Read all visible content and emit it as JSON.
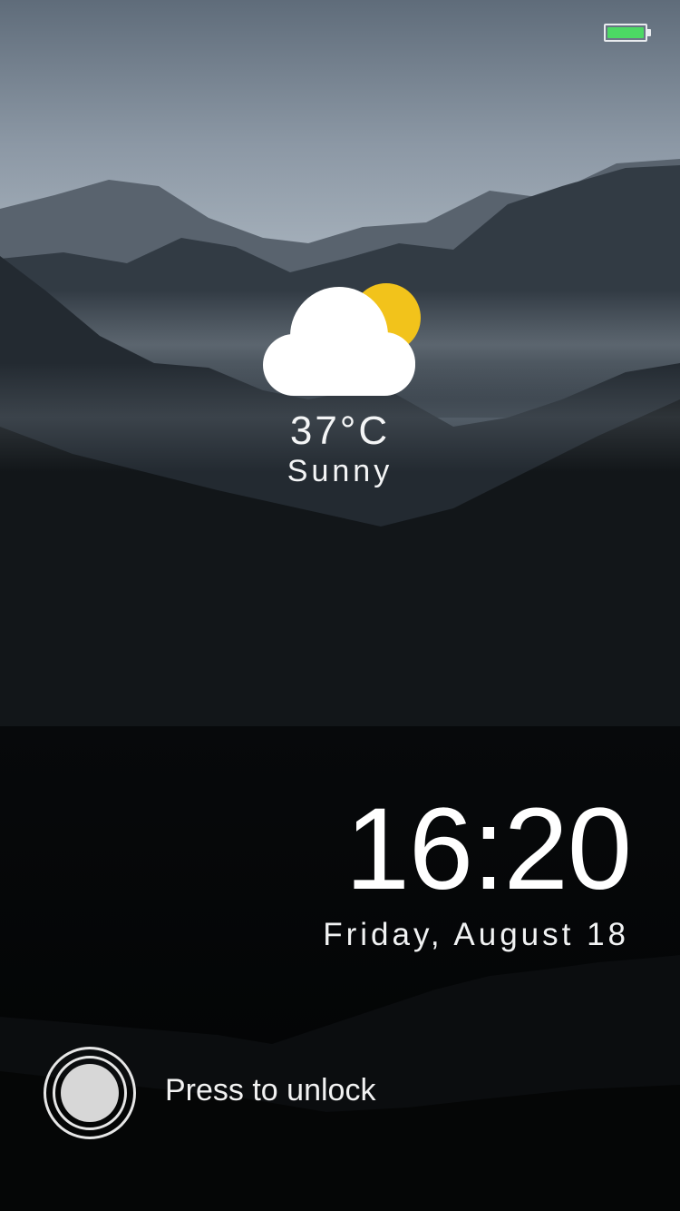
{
  "status_bar": {
    "battery_level": 1.0,
    "battery_color": "#4cd964"
  },
  "weather": {
    "icon": "partly-sunny-icon",
    "temperature": "37°C",
    "condition": "Sunny",
    "sun_color": "#f2c31b",
    "cloud_color": "#ffffff"
  },
  "clock": {
    "time": "16:20",
    "date": "Friday, August 18"
  },
  "unlock": {
    "label": "Press to unlock",
    "icon": "unlock-knob-icon"
  }
}
